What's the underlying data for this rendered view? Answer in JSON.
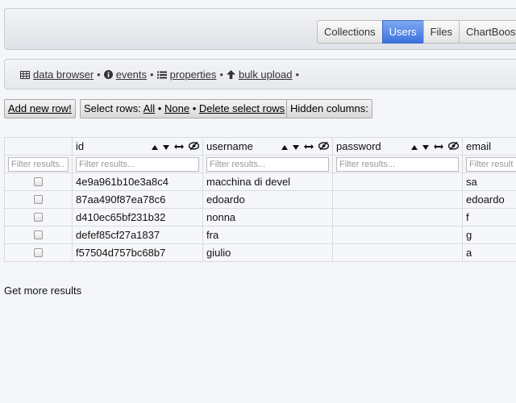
{
  "tabs": [
    {
      "label": "Collections",
      "active": false
    },
    {
      "label": "Users",
      "active": true
    },
    {
      "label": "Files",
      "active": false
    },
    {
      "label": "ChartBoost",
      "active": false
    }
  ],
  "subnav": {
    "data_browser": "data browser",
    "events": "events",
    "properties": "properties",
    "bulk_upload": "bulk upload",
    "separator": "•"
  },
  "toolbar": {
    "add_row": "Add new row!",
    "select_rows_label": "Select rows:",
    "select_all": "All",
    "select_none": "None",
    "delete_rows": "Delete select rows",
    "hidden_columns": "Hidden columns:",
    "separator": "•"
  },
  "table": {
    "columns": [
      "id",
      "username",
      "password",
      "email"
    ],
    "filter_placeholder": "Filter results...",
    "rows": [
      {
        "id": "4e9a961b10e3a8c4",
        "username": "macchina di devel",
        "password": "",
        "email": "sa"
      },
      {
        "id": "87aa490f87ea78c6",
        "username": "edoardo",
        "password": "",
        "email": "edoardo"
      },
      {
        "id": "d410ec65bf231b32",
        "username": "nonna",
        "password": "",
        "email": "f"
      },
      {
        "id": "defef85cf27a1837",
        "username": "fra",
        "password": "",
        "email": "g"
      },
      {
        "id": "f57504d757bc68b7",
        "username": "giulio",
        "password": "",
        "email": "a"
      }
    ]
  },
  "footer": {
    "more_results": "Get more results"
  },
  "colors": {
    "active_tab": "#3b72e0",
    "background": "#f4f6fa"
  }
}
